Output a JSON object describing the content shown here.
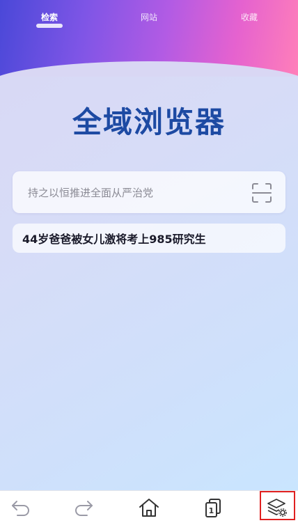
{
  "tabs": [
    {
      "label": "检索",
      "active": true
    },
    {
      "label": "网站",
      "active": false
    },
    {
      "label": "收藏",
      "active": false
    }
  ],
  "title": "全域浏览器",
  "search": {
    "placeholder": "持之以恒推进全面从严治党"
  },
  "hot_item": "44岁爸爸被女儿激将考上985研究生",
  "bottom_nav": {
    "tab_count": "1",
    "icons": [
      "back-icon",
      "forward-icon",
      "home-icon",
      "tabs-icon",
      "layers-settings-icon"
    ]
  },
  "colors": {
    "title": "#1d4aa3",
    "highlight": "#e02020"
  }
}
